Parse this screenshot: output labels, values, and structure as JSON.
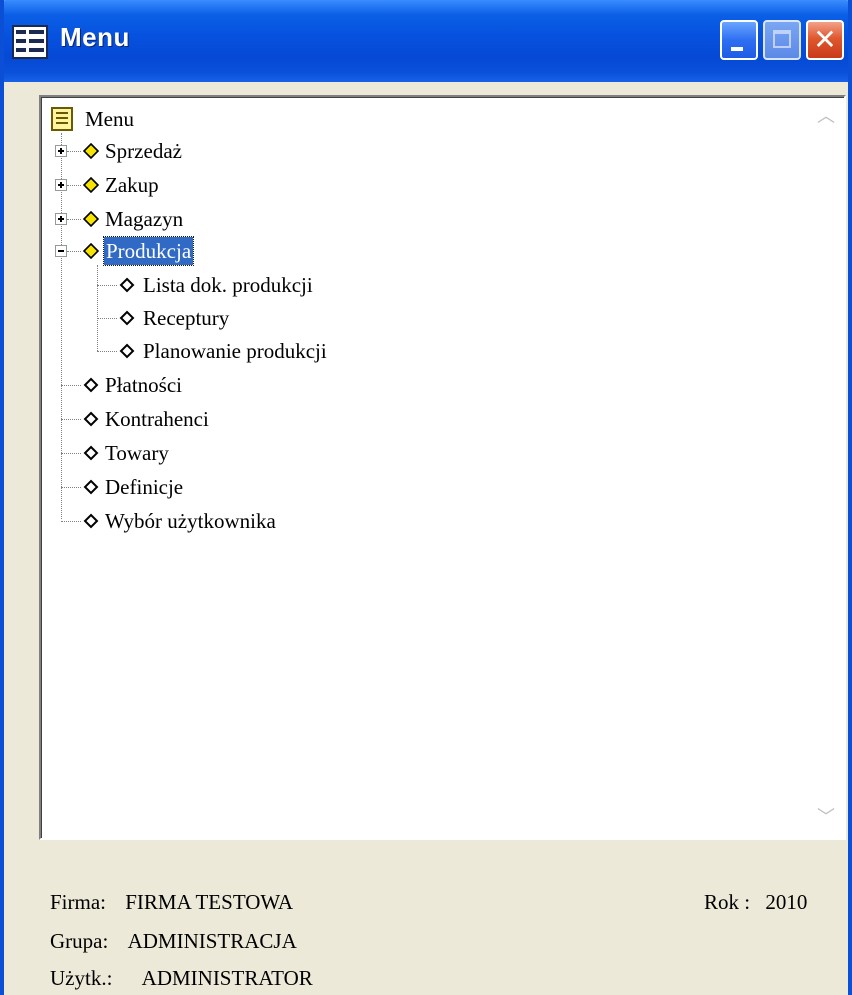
{
  "window": {
    "title": "Menu"
  },
  "tree": {
    "root_label": "Menu",
    "items": [
      {
        "label": "Sprzedaż",
        "expandable": true,
        "expanded": false,
        "icon": "yellow-diamond"
      },
      {
        "label": "Zakup",
        "expandable": true,
        "expanded": false,
        "icon": "yellow-diamond"
      },
      {
        "label": "Magazyn",
        "expandable": true,
        "expanded": false,
        "icon": "yellow-diamond"
      },
      {
        "label": "Produkcja",
        "expandable": true,
        "expanded": true,
        "selected": true,
        "icon": "yellow-diamond",
        "children": [
          {
            "label": "Lista dok. produkcji",
            "icon": "white-diamond"
          },
          {
            "label": "Receptury",
            "icon": "white-diamond"
          },
          {
            "label": "Planowanie produkcji",
            "icon": "white-diamond"
          }
        ]
      },
      {
        "label": "Płatności",
        "icon": "white-diamond"
      },
      {
        "label": "Kontrahenci",
        "icon": "white-diamond"
      },
      {
        "label": "Towary",
        "icon": "white-diamond"
      },
      {
        "label": "Definicje",
        "icon": "white-diamond"
      },
      {
        "label": "Wybór użytkownika",
        "icon": "white-diamond"
      }
    ]
  },
  "footer": {
    "firma_label": "Firma:",
    "firma_value": "FIRMA TESTOWA",
    "rok_label": "Rok :",
    "rok_value": "2010",
    "grupa_label": "Grupa:",
    "grupa_value": "ADMINISTRACJA",
    "uzytk_label": "Użytk.:",
    "uzytk_value": "ADMINISTRATOR"
  },
  "colors": {
    "titlebar": "#0549d6",
    "selection": "#316ac5",
    "node_icon_yellow": "#f5e400",
    "window_face": "#ece9d8"
  }
}
